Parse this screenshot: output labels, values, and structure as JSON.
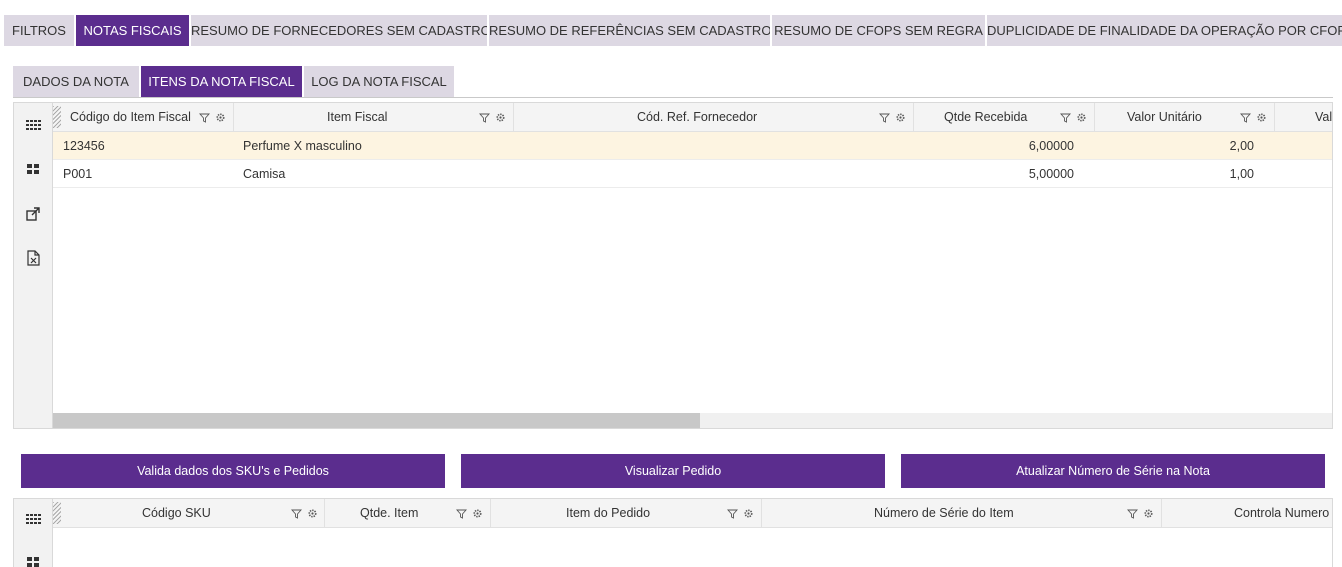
{
  "top_tabs": [
    {
      "label": "FILTROS"
    },
    {
      "label": "NOTAS FISCAIS"
    },
    {
      "label": "RESUMO DE FORNECEDORES SEM CADASTRO"
    },
    {
      "label": "RESUMO DE REFERÊNCIAS SEM CADASTRO"
    },
    {
      "label": "RESUMO DE CFOPS SEM REGRA"
    },
    {
      "label": "DUPLICIDADE DE FINALIDADE DA OPERAÇÃO POR CFOP"
    }
  ],
  "active_top_tab": "NOTAS FISCAIS",
  "sub_tabs": [
    {
      "label": "DADOS DA NOTA"
    },
    {
      "label": "ITENS DA NOTA FISCAL"
    },
    {
      "label": "LOG DA NOTA FISCAL"
    }
  ],
  "active_sub_tab": "ITENS DA NOTA FISCAL",
  "items_grid": {
    "columns": [
      "Código do Item Fiscal",
      "Item Fiscal",
      "Cód. Ref. Fornecedor",
      "Qtde Recebida",
      "Valor Unitário",
      "Valo"
    ],
    "rows": [
      [
        "123456",
        "Perfume X masculino",
        "",
        "6,00000",
        "2,00",
        ""
      ],
      [
        "P001",
        "Camisa",
        "",
        "5,00000",
        "1,00",
        ""
      ]
    ],
    "selected_row": 0
  },
  "buttons": {
    "validate": "Valida dados dos SKU's e Pedidos",
    "view_order": "Visualizar Pedido",
    "update_serial": "Atualizar Número de Série na Nota"
  },
  "sku_grid": {
    "columns": [
      "Código SKU",
      "Qtde. Item",
      "Item do Pedido",
      "Número de Série do Item",
      "Controla Numero"
    ]
  },
  "colors": {
    "accent": "#5b2d8e",
    "tab_inactive": "#ddd8e3",
    "selected_row": "#fdf4e1"
  },
  "icons": [
    "grid-view-icon",
    "tiles-view-icon",
    "open-external-icon",
    "excel-export-icon",
    "filter-icon",
    "settings-icon"
  ]
}
